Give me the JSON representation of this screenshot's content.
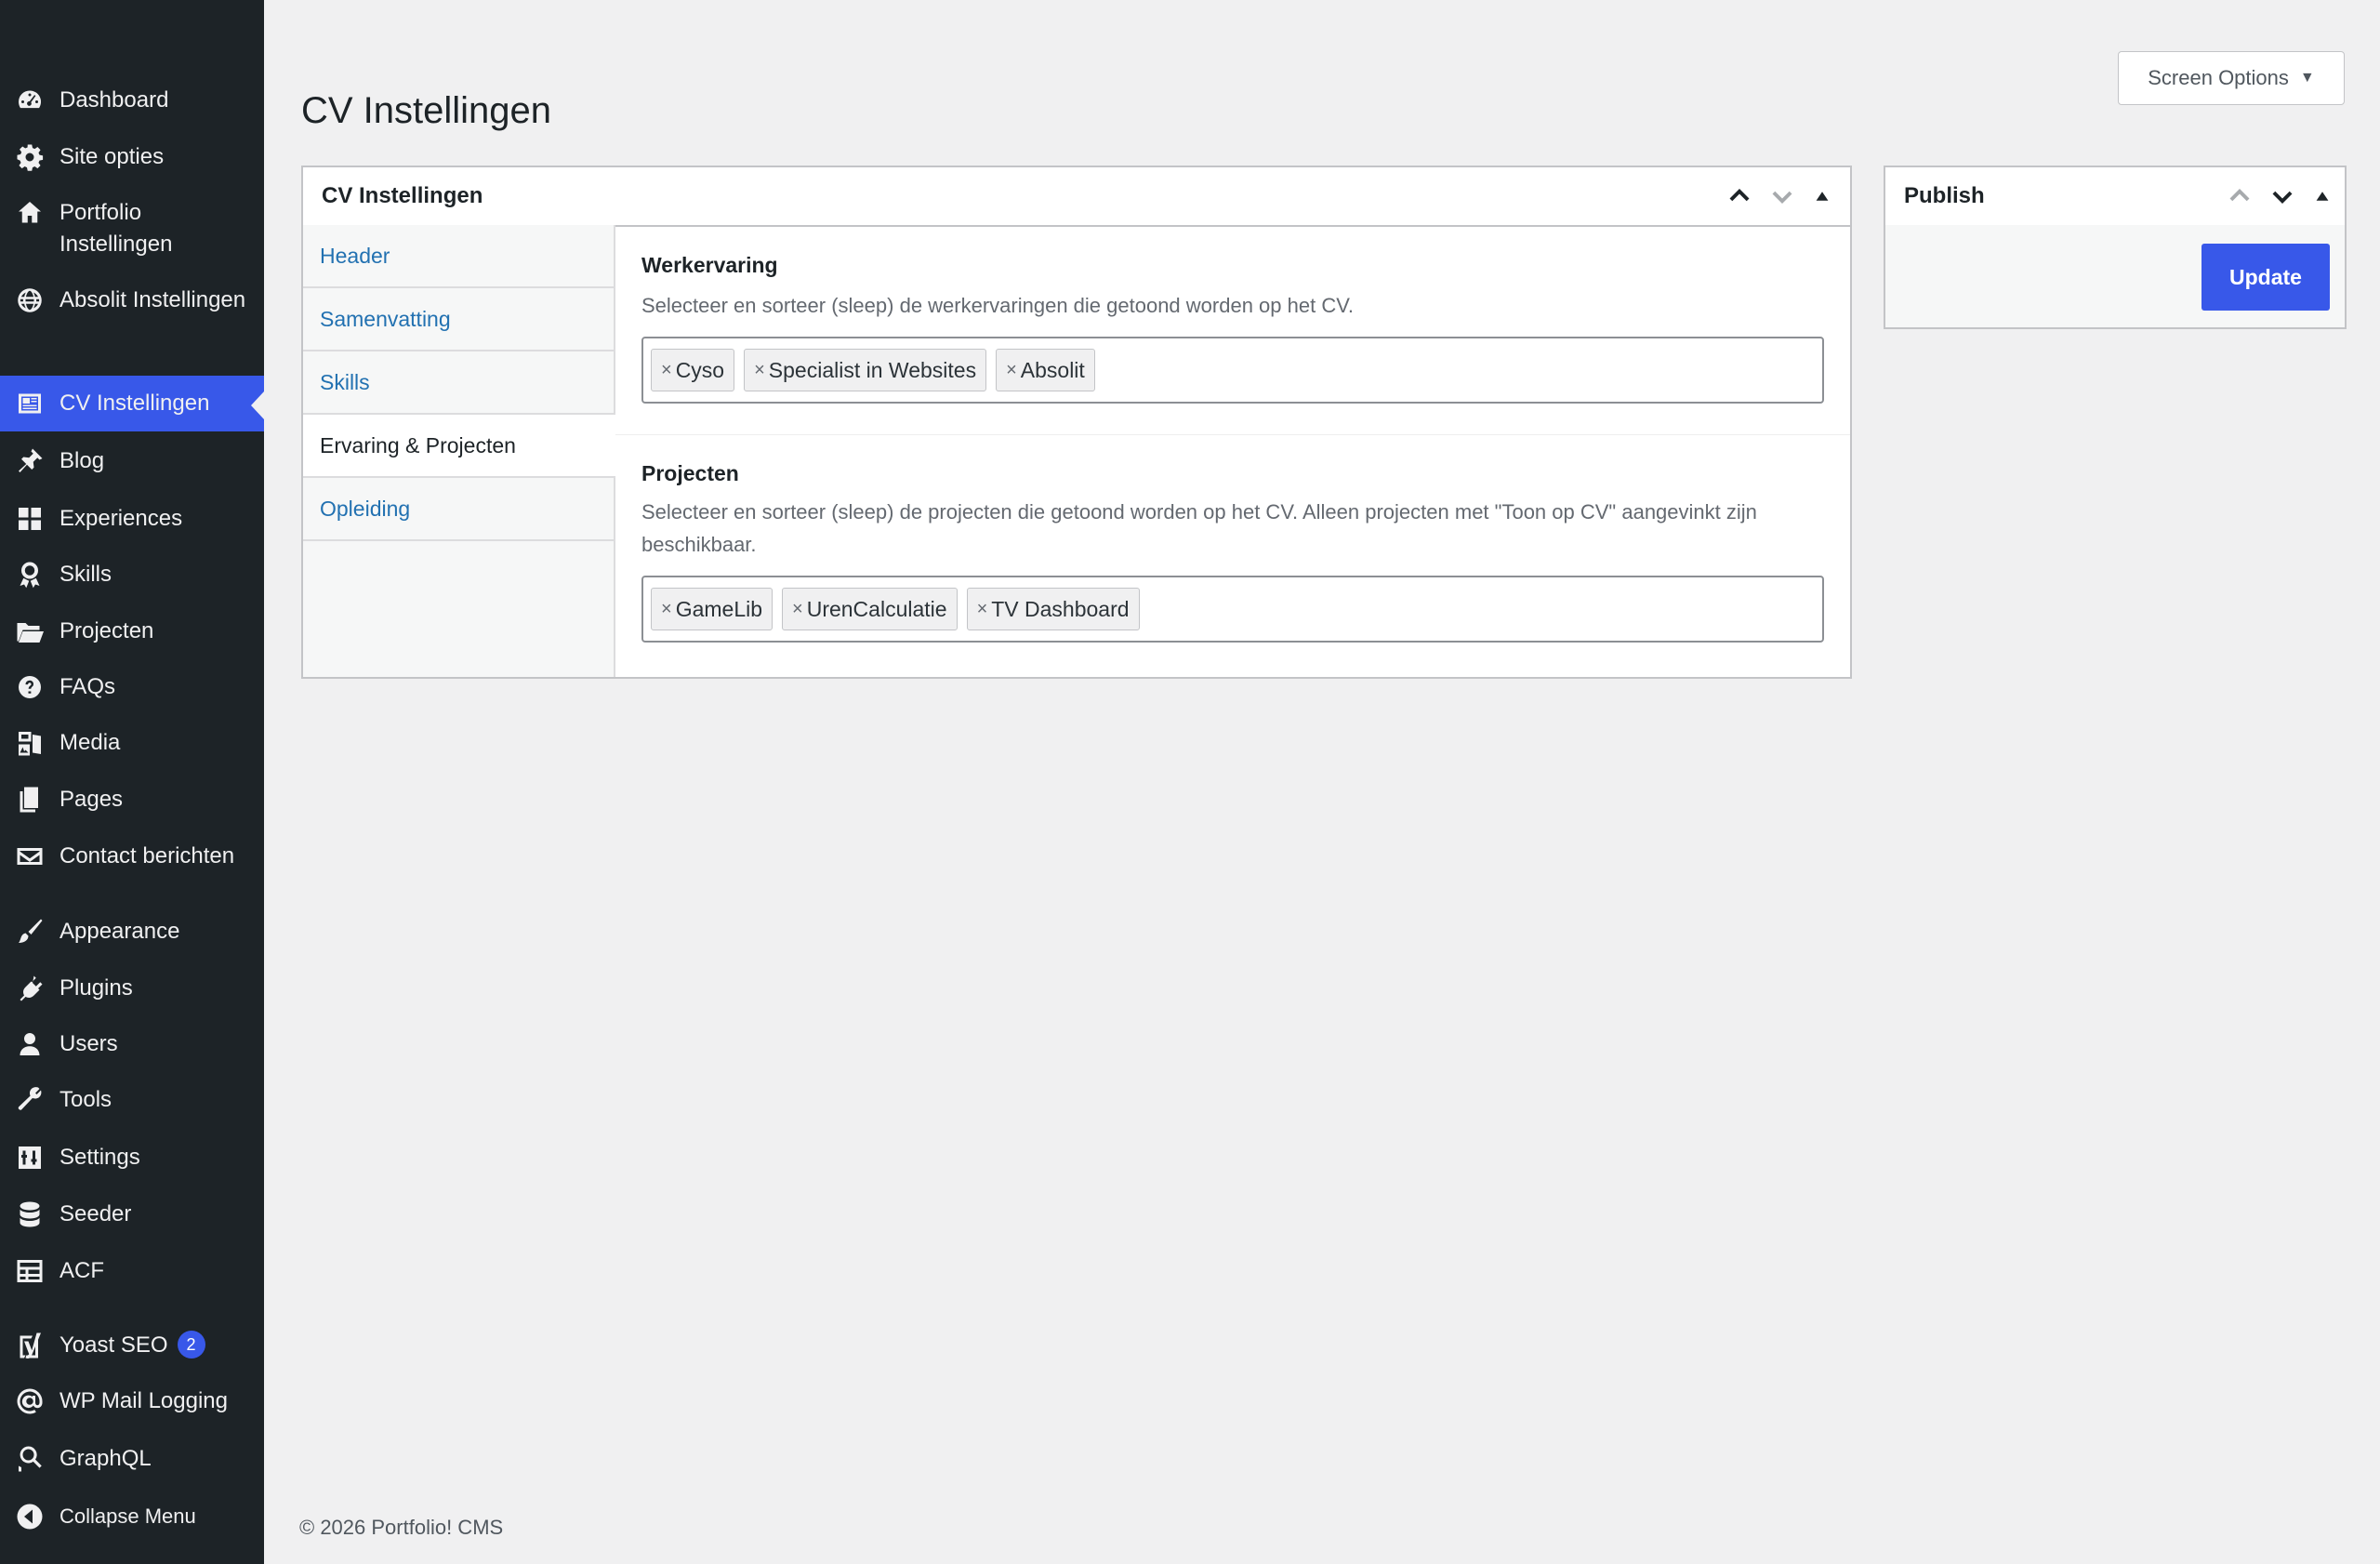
{
  "sidebar": {
    "items": [
      {
        "label": "Dashboard",
        "icon": "dashboard-icon"
      },
      {
        "label": "Site opties",
        "icon": "gear-icon"
      },
      {
        "label": "Portfolio Instellingen",
        "icon": "home-icon"
      },
      {
        "label": "Absolit Instellingen",
        "icon": "globe-icon"
      },
      {
        "label": "CV Instellingen",
        "icon": "id-card-icon",
        "active": true
      },
      {
        "label": "Blog",
        "icon": "pin-icon"
      },
      {
        "label": "Experiences",
        "icon": "grid-icon"
      },
      {
        "label": "Skills",
        "icon": "award-icon"
      },
      {
        "label": "Projecten",
        "icon": "folder-icon"
      },
      {
        "label": "FAQs",
        "icon": "help-icon"
      },
      {
        "label": "Media",
        "icon": "media-icon"
      },
      {
        "label": "Pages",
        "icon": "pages-icon"
      },
      {
        "label": "Contact berichten",
        "icon": "envelope-icon"
      },
      {
        "label": "Appearance",
        "icon": "brush-icon"
      },
      {
        "label": "Plugins",
        "icon": "plug-icon"
      },
      {
        "label": "Users",
        "icon": "user-icon"
      },
      {
        "label": "Tools",
        "icon": "wrench-icon"
      },
      {
        "label": "Settings",
        "icon": "sliders-icon"
      },
      {
        "label": "Seeder",
        "icon": "database-icon"
      },
      {
        "label": "ACF",
        "icon": "table-icon"
      },
      {
        "label": "Yoast SEO",
        "icon": "yoast-icon",
        "badge": "2"
      },
      {
        "label": "WP Mail Logging",
        "icon": "at-icon"
      },
      {
        "label": "GraphQL",
        "icon": "graphql-icon"
      },
      {
        "label": "Collapse Menu",
        "icon": "collapse-icon"
      }
    ]
  },
  "header": {
    "screen_options": "Screen Options",
    "page_title": "CV Instellingen"
  },
  "cv_box": {
    "title": "CV Instellingen",
    "tabs": [
      "Header",
      "Samenvatting",
      "Skills",
      "Ervaring & Projecten",
      "Opleiding"
    ],
    "current_tab": "Ervaring & Projecten",
    "fields": [
      {
        "label": "Werkervaring",
        "description": "Selecteer en sorteer (sleep) de werkervaringen die getoond worden op het CV.",
        "chips": [
          "Cyso",
          "Specialist in Websites",
          "Absolit"
        ]
      },
      {
        "label": "Projecten",
        "description": "Selecteer en sorteer (sleep) de projecten die getoond worden op het CV. Alleen projecten met \"Toon op CV\" aangevinkt zijn beschikbaar.",
        "chips": [
          "GameLib",
          "UrenCalculatie",
          "TV Dashboard"
        ]
      }
    ]
  },
  "publish_box": {
    "title": "Publish",
    "update_label": "Update"
  },
  "footer": {
    "text": "© 2026 Portfolio! CMS"
  },
  "colors": {
    "sidebar_bg": "#1d2327",
    "accent": "#3858e9",
    "link": "#2271b1",
    "page_bg": "#f0f0f1"
  }
}
